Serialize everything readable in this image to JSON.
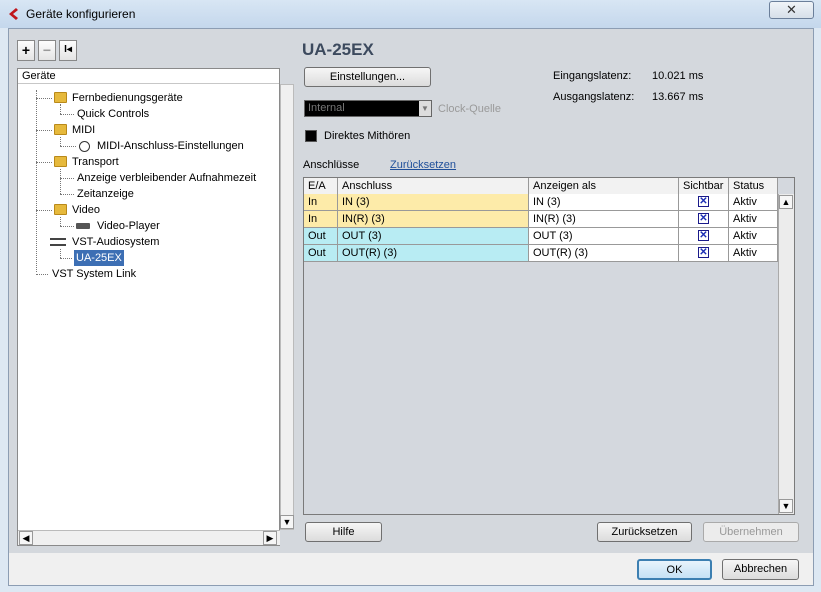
{
  "window": {
    "title": "Geräte konfigurieren",
    "close_glyph": "✕"
  },
  "toolbar": {
    "add": "+",
    "remove": "−",
    "reset": "I◂"
  },
  "tree": {
    "header": "Geräte",
    "items": [
      {
        "label": "Fernbedienungsgeräte",
        "icon": "folder-icon"
      },
      {
        "label": "Quick Controls"
      },
      {
        "label": "MIDI",
        "icon": "folder-icon"
      },
      {
        "label": "MIDI-Anschluss-Einstellungen",
        "icon": "midi-port-icon"
      },
      {
        "label": "Transport",
        "icon": "folder-icon"
      },
      {
        "label": "Anzeige verbleibender Aufnahmezeit"
      },
      {
        "label": "Zeitanzeige"
      },
      {
        "label": "Video",
        "icon": "folder-icon"
      },
      {
        "label": "Video-Player",
        "icon": "video-player-icon"
      },
      {
        "label": "VST-Audiosystem",
        "icon": "audio-system-icon"
      },
      {
        "label": "UA-25EX",
        "selected": true
      },
      {
        "label": "VST System Link"
      }
    ]
  },
  "device": {
    "title": "UA-25EX",
    "settings_button": "Einstellungen...",
    "clock_value": "Internal",
    "clock_label": "Clock-Quelle",
    "direct_monitoring": "Direktes Mithören",
    "input_latency_label": "Eingangslatenz:",
    "input_latency_value": "10.021 ms",
    "output_latency_label": "Ausgangslatenz:",
    "output_latency_value": "13.667 ms",
    "ports_label": "Anschlüsse",
    "reset_link": "Zurücksetzen"
  },
  "table": {
    "columns": [
      "E/A",
      "Anschluss",
      "Anzeigen als",
      "Sichtbar",
      "Status"
    ],
    "rows": [
      {
        "io": "In",
        "port": "IN (3)",
        "show_as": "IN (3)",
        "visible": "✕",
        "status": "Aktiv"
      },
      {
        "io": "In",
        "port": "IN(R) (3)",
        "show_as": "IN(R) (3)",
        "visible": "✕",
        "status": "Aktiv"
      },
      {
        "io": "Out",
        "port": "OUT (3)",
        "show_as": "OUT (3)",
        "visible": "✕",
        "status": "Aktiv"
      },
      {
        "io": "Out",
        "port": "OUT(R) (3)",
        "show_as": "OUT(R) (3)",
        "visible": "✕",
        "status": "Aktiv"
      }
    ]
  },
  "footer": {
    "help": "Hilfe",
    "reset": "Zurücksetzen",
    "apply": "Übernehmen",
    "ok": "OK",
    "cancel": "Abbrechen"
  },
  "colors": {
    "in_row": "#fdeba9",
    "out_row": "#b8ecf3",
    "selection": "#3d6fb4"
  }
}
